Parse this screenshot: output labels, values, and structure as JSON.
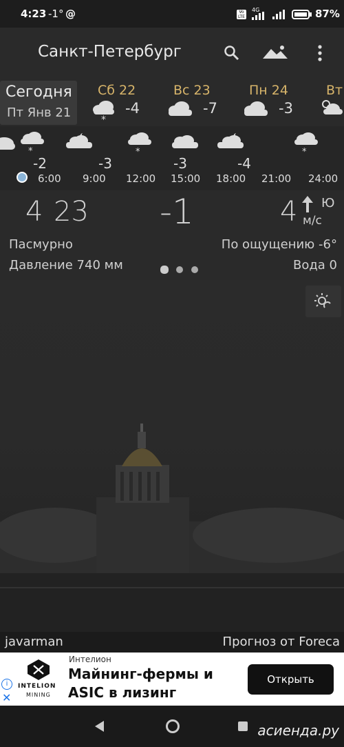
{
  "status": {
    "time": "4:23",
    "temp": "-1°",
    "at": "@",
    "volte": "Vo\nLTE",
    "network": "4G",
    "battery": "87%"
  },
  "toolbar": {
    "city": "Санкт-Петербург"
  },
  "days": [
    {
      "name": "Сегодня",
      "sub": "Пт Янв 21"
    },
    {
      "name": "Сб 22",
      "temp": "-4",
      "icon": "cloud-snow-icon"
    },
    {
      "name": "Вс 23",
      "temp": "-7",
      "icon": "cloud-icon"
    },
    {
      "name": "Пн 24",
      "temp": "-3",
      "icon": "cloud-icon"
    },
    {
      "name": "Вт",
      "icon": "sun-cloud-icon"
    }
  ],
  "hourly": {
    "temps": [
      "-2",
      "-3",
      "-3",
      "-4"
    ],
    "times": [
      "6:00",
      "9:00",
      "12:00",
      "15:00",
      "18:00",
      "21:00",
      "24:00"
    ]
  },
  "current": {
    "time_h": "4",
    "time_m": "23",
    "temp": "-1",
    "wind": "4",
    "wind_dir": "Ю",
    "wind_unit": "м/с",
    "condition": "Пасмурно",
    "feels": "По ощущению -6°",
    "pressure": "Давление 740 мм",
    "water": "Вода 0"
  },
  "footer": {
    "author": "javarman",
    "source": "Прогноз от Foreca"
  },
  "ad": {
    "brand": "Интелион",
    "title_line1": "Майнинг-фермы и",
    "title_line2": "ASIC в лизинг",
    "logo_text": "INTELION",
    "logo_sub": "MINING",
    "cta": "Открыть"
  },
  "watermark": "асиенда.ру",
  "colors": {
    "accent": "#d7b46a",
    "dot": "#8ab4d8"
  }
}
